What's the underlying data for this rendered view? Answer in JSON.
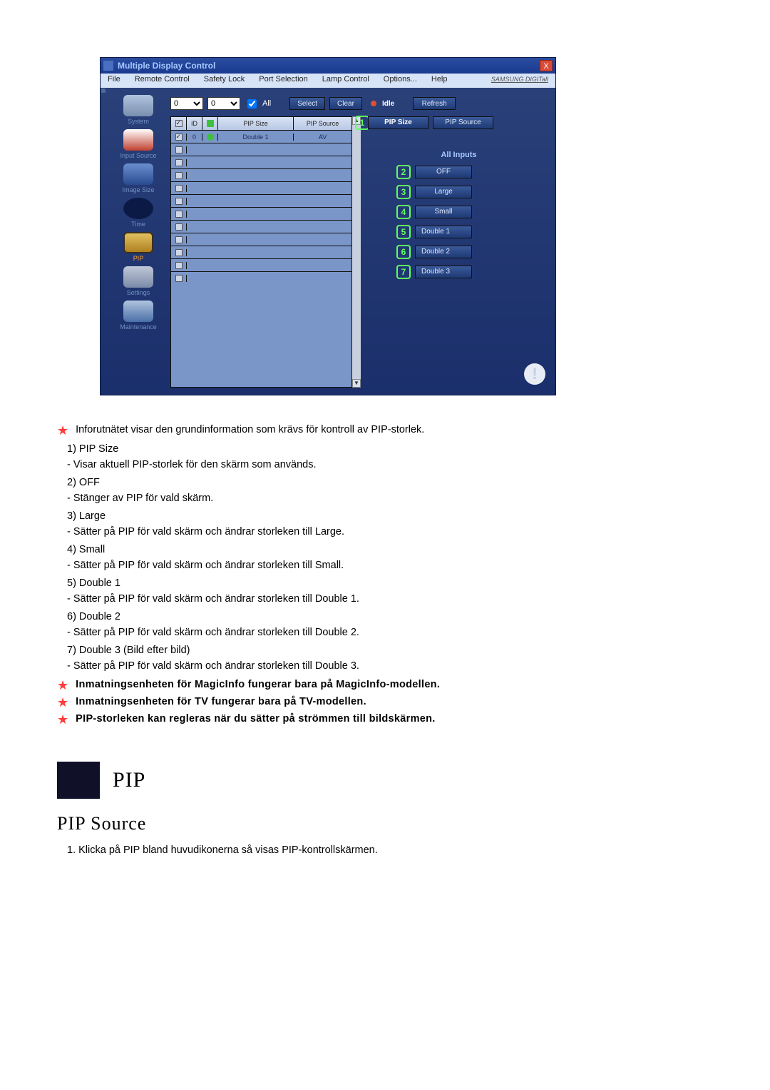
{
  "window": {
    "title": "Multiple Display Control",
    "close": "X"
  },
  "menu": [
    "File",
    "Remote Control",
    "Safety Lock",
    "Port Selection",
    "Lamp Control",
    "Options...",
    "Help"
  ],
  "brand": "SAMSUNG DIGITall",
  "top": {
    "sel1": "0",
    "sel2": "0",
    "all": "All",
    "select": "Select",
    "clear": "Clear",
    "idle": "Idle",
    "refresh": "Refresh"
  },
  "sidebar": [
    {
      "label": "System"
    },
    {
      "label": "Input Source"
    },
    {
      "label": "Image Size"
    },
    {
      "label": "Time"
    },
    {
      "label": "PIP",
      "active": true
    },
    {
      "label": "Settings"
    },
    {
      "label": "Maintenance"
    }
  ],
  "grid": {
    "headers": {
      "chk": "",
      "id": "ID",
      "status": "",
      "size": "PIP Size",
      "source": "PIP Source"
    },
    "rows": [
      {
        "checked": true,
        "id": "0",
        "status": "green",
        "size": "Double 1",
        "source": "AV"
      },
      {
        "checked": false
      },
      {
        "checked": false
      },
      {
        "checked": false
      },
      {
        "checked": false
      },
      {
        "checked": false
      },
      {
        "checked": false
      },
      {
        "checked": false
      },
      {
        "checked": false
      },
      {
        "checked": false
      },
      {
        "checked": false
      },
      {
        "checked": false
      }
    ]
  },
  "right": {
    "pip_size": "PIP Size",
    "pip_source": "PIP Source",
    "section": "All Inputs",
    "options": [
      {
        "n": "2",
        "label": "OFF"
      },
      {
        "n": "3",
        "label": "Large"
      },
      {
        "n": "4",
        "label": "Small"
      },
      {
        "n": "5",
        "label": "Double 1"
      },
      {
        "n": "6",
        "label": "Double 2"
      },
      {
        "n": "7",
        "label": "Double 3"
      }
    ],
    "callout1": "1"
  },
  "doc": {
    "intro": "Inforutnätet visar den grundinformation som krävs för kontroll av PIP-storlek.",
    "items": [
      {
        "t": "1)  PIP Size",
        "d": "- Visar aktuell PIP-storlek för den skärm som används."
      },
      {
        "t": "2)  OFF",
        "d": "- Stänger av PIP för vald skärm."
      },
      {
        "t": "3)  Large",
        "d": "- Sätter på PIP för vald skärm och ändrar storleken till Large."
      },
      {
        "t": "4)  Small",
        "d": "- Sätter på PIP för vald skärm och ändrar storleken till Small."
      },
      {
        "t": "5)  Double 1",
        "d": "- Sätter på PIP för vald skärm och ändrar storleken till Double 1."
      },
      {
        "t": "6)  Double 2",
        "d": "- Sätter på PIP för vald skärm och ändrar storleken till Double 2."
      },
      {
        "t": "7)  Double 3 (Bild efter bild)",
        "d": "- Sätter på PIP för vald skärm och ändrar storleken till Double 3."
      }
    ],
    "notes": [
      "Inmatningsenheten för MagicInfo fungerar bara på MagicInfo-modellen.",
      "Inmatningsenheten för TV fungerar bara på TV-modellen.",
      "PIP-storleken kan regleras när du sätter på strömmen till bildskärmen."
    ],
    "pip_heading": "PIP",
    "pip_sub": "PIP Source",
    "pip_step1": "1.   Klicka på PIP bland huvudikonerna så visas PIP-kontrollskärmen."
  }
}
